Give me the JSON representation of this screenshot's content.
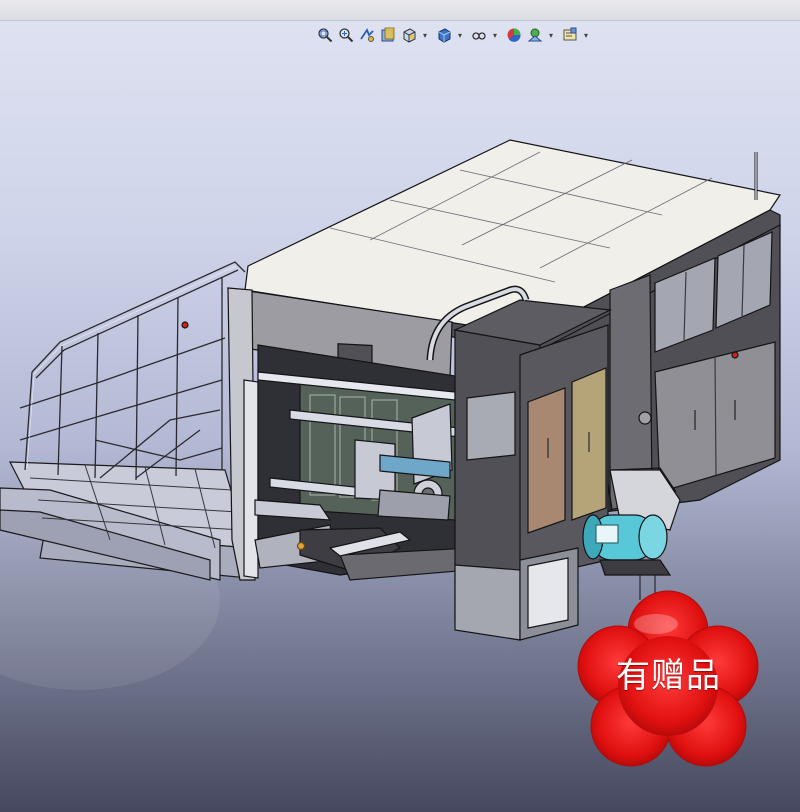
{
  "toolbar": {
    "items": [
      {
        "icon": "zoom-to-fit-icon",
        "dropdown": false
      },
      {
        "icon": "zoom-to-area-icon",
        "dropdown": false
      },
      {
        "icon": "previous-view-icon",
        "dropdown": false
      },
      {
        "icon": "section-view-icon",
        "dropdown": false
      },
      {
        "icon": "view-orientation-icon",
        "dropdown": true
      },
      {
        "icon": "display-style-icon",
        "dropdown": true
      },
      {
        "icon": "hide-show-items-icon",
        "dropdown": true
      },
      {
        "icon": "edit-appearance-icon",
        "dropdown": false
      },
      {
        "icon": "apply-scene-icon",
        "dropdown": true
      },
      {
        "icon": "view-settings-icon",
        "dropdown": true
      }
    ]
  },
  "badge": {
    "text": "有赠品",
    "color": "#e01010"
  },
  "colors": {
    "machine_panel": "#58585e",
    "roof_panel": "#f0eeea",
    "frame": "#c8cad6",
    "motor": "#58c8d8",
    "door_left": "#a88870",
    "door_right": "#b4a478"
  }
}
